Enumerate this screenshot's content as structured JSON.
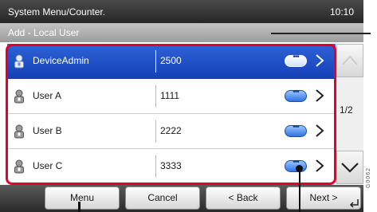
{
  "header": {
    "title": "System Menu/Counter.",
    "time": "10:10"
  },
  "subheader": {
    "title": "Add - Local User",
    "search_placeholder": ""
  },
  "users": [
    {
      "name": "DeviceAdmin",
      "number": "2500",
      "selected": true
    },
    {
      "name": "User A",
      "number": "1111",
      "selected": false
    },
    {
      "name": "User B",
      "number": "2222",
      "selected": false
    },
    {
      "name": "User C",
      "number": "3333",
      "selected": false
    }
  ],
  "pager": {
    "page": "1/2"
  },
  "footer": {
    "menu": "Menu",
    "cancel": "Cancel",
    "back": "< Back",
    "next": "Next >"
  },
  "side_code": "G0062"
}
